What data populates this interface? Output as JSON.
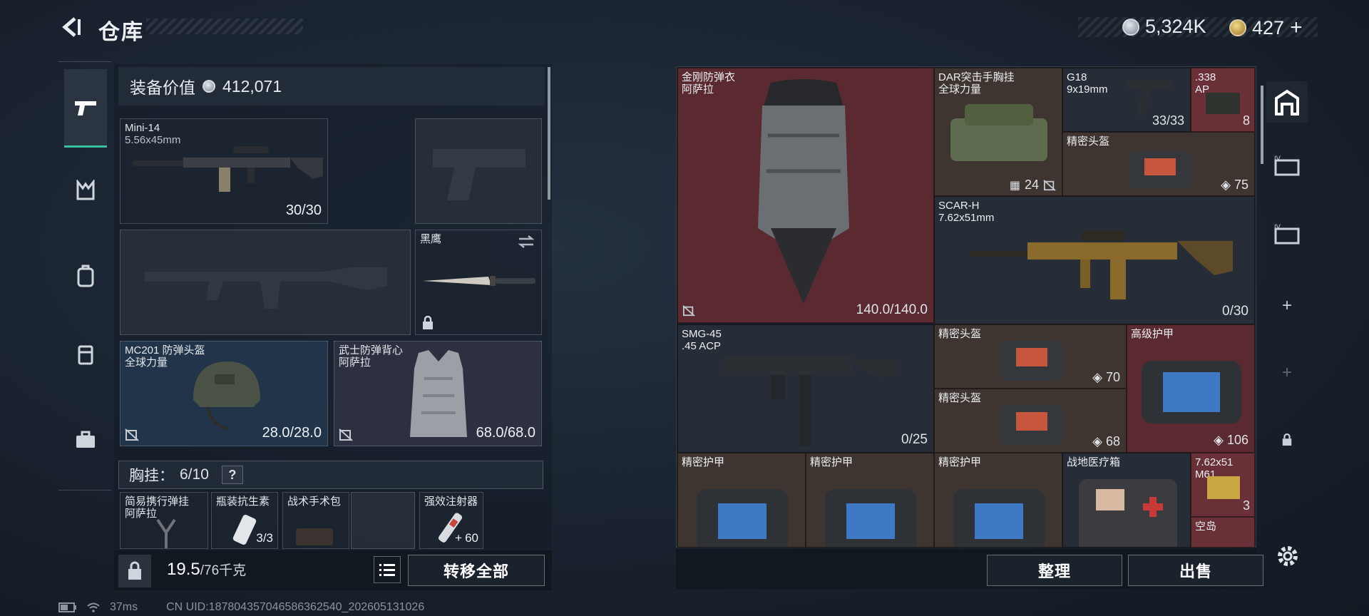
{
  "header": {
    "title": "仓库",
    "currency": [
      {
        "icon": "silver-coin-icon",
        "value": "5,324K"
      },
      {
        "icon": "gold-coin-icon",
        "value": "427",
        "plus": "+"
      }
    ]
  },
  "loadout": {
    "value_label": "装备价值",
    "value": "412,071",
    "primary": {
      "name": "Mini-14",
      "caliber": "5.56x45mm",
      "ammo": "30/30"
    },
    "melee": {
      "name": "黑鹰"
    },
    "helmet": {
      "name": "MC201 防弹头盔",
      "maker": "全球力量",
      "durability": "28.0/28.0"
    },
    "armor": {
      "name": "武士防弹背心",
      "maker": "阿萨拉",
      "durability": "68.0/68.0"
    },
    "rig": {
      "label": "胸挂：",
      "capacity": "6/10",
      "help": "?"
    },
    "rig_items": [
      {
        "name": "简易携行弹挂",
        "maker": "阿萨拉"
      },
      {
        "name": "瓶装抗生素",
        "count": "3/3"
      },
      {
        "name": "战术手术包"
      },
      {
        "name": ""
      },
      {
        "name": "强效注射器",
        "count": "60"
      }
    ],
    "weight": "19.5",
    "weight_max": "/76千克",
    "transfer_all": "转移全部"
  },
  "stash": {
    "items": [
      {
        "name": "金刚防弹衣",
        "maker": "阿萨拉",
        "value": "140.0/140.0"
      },
      {
        "name": "DAR突击手胸挂",
        "maker": "全球力量",
        "slots": "24"
      },
      {
        "name": "G18",
        "caliber": "9x19mm",
        "ammo": "33/33"
      },
      {
        "name": ".338",
        "sub": "AP",
        "count": "8"
      },
      {
        "name": "精密头盔",
        "armor": "75"
      },
      {
        "name": "SCAR-H",
        "caliber": "7.62x51mm",
        "ammo": "0/30"
      },
      {
        "name": "SMG-45",
        "caliber": ".45 ACP",
        "ammo": "0/25"
      },
      {
        "name": "精密头盔",
        "armor": "70"
      },
      {
        "name": "高级护甲",
        "armor": "106"
      },
      {
        "name": "精密头盔",
        "armor": "68"
      },
      {
        "name": "精密护甲"
      },
      {
        "name": "精密护甲"
      },
      {
        "name": "精密护甲"
      },
      {
        "name": "战地医疗箱"
      },
      {
        "name": "7.62x51",
        "sub": "M61",
        "count": "3"
      },
      {
        "name": "空岛"
      }
    ],
    "sort_label": "整理",
    "sell_label": "出售"
  },
  "status": {
    "ping": "37ms",
    "uid": "CN UID:187804357046586362540_202605131026"
  },
  "colors": {
    "accent": "#38c2a0",
    "red_cell": "#5a2a30",
    "brown_cell": "#3e3430"
  }
}
